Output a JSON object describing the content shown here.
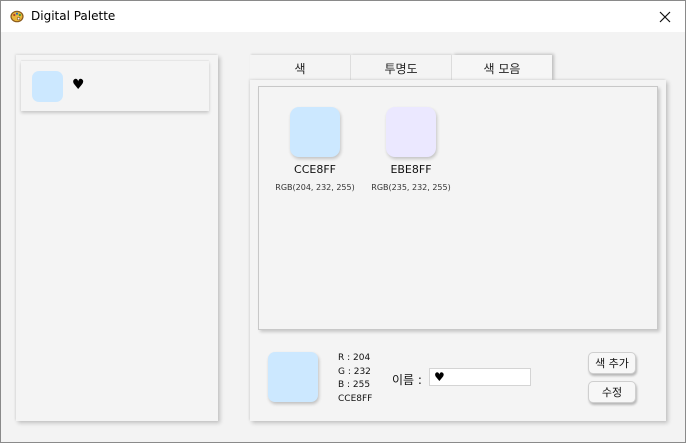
{
  "window": {
    "title": "Digital Palette"
  },
  "saved_colors": [
    {
      "name": "♥",
      "color": "#CCE8FF"
    }
  ],
  "tabs": [
    {
      "label": "색",
      "active": false
    },
    {
      "label": "투명도",
      "active": false
    },
    {
      "label": "색 모음",
      "active": true
    }
  ],
  "collection": [
    {
      "hex": "CCE8FF",
      "rgb": "RGB(204, 232, 255)",
      "color": "#CCE8FF"
    },
    {
      "hex": "EBE8FF",
      "rgb": "RGB(235, 232, 255)",
      "color": "#EBE8FF"
    }
  ],
  "current": {
    "color": "#CCE8FF",
    "r_text": "R : 204",
    "g_text": "G : 232",
    "b_text": "B : 255",
    "hex": "CCE8FF",
    "name_label": "이름 :",
    "name_value": "♥"
  },
  "buttons": {
    "add_label": "색 추가",
    "edit_label": "수정"
  },
  "colors": {
    "icon_brown": "#8a5a1c",
    "icon_gold": "#e8b53a"
  }
}
